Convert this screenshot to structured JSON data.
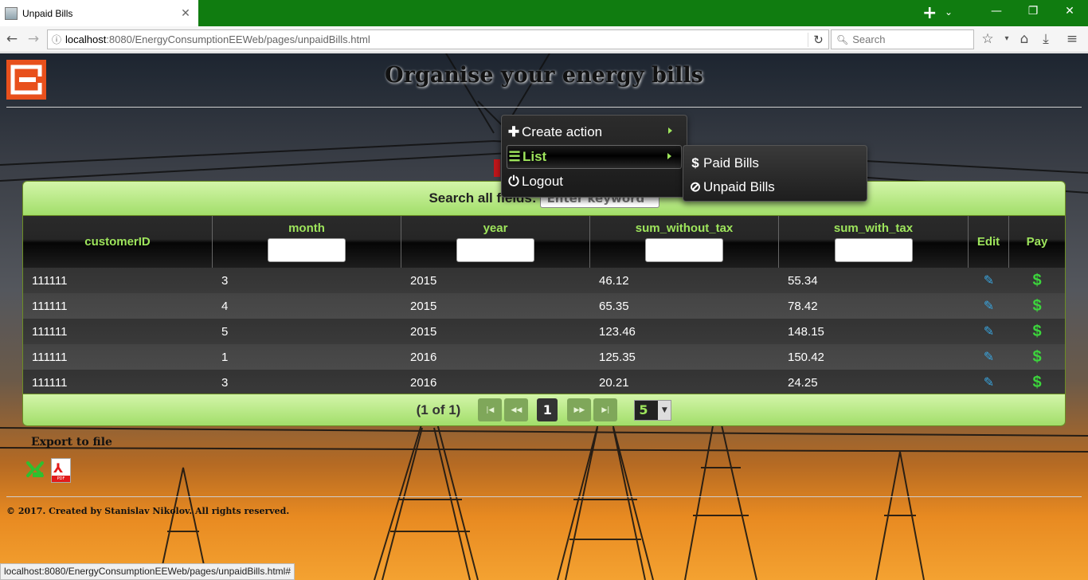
{
  "browser": {
    "tab_title": "Unpaid Bills",
    "tab_close": "✕",
    "url_host": "localhost",
    "url_rest": ":8080/EnergyConsumptionEEWeb/pages/unpaidBills.html",
    "search_placeholder": "Search",
    "status_text": "localhost:8080/EnergyConsumptionEEWeb/pages/unpaidBills.html#",
    "accent_color": "#107c10"
  },
  "header": {
    "title": "Organise your energy bills"
  },
  "menu": {
    "items": [
      {
        "label": "Create action",
        "icon": "plus-icon"
      },
      {
        "label": "List",
        "icon": "list-icon"
      },
      {
        "label": "Logout",
        "icon": "power-icon"
      }
    ],
    "submenu": [
      {
        "label": "Paid Bills",
        "icon": "dollar-icon"
      },
      {
        "label": "Unpaid Bills",
        "icon": "ban-icon"
      }
    ]
  },
  "table": {
    "search_label": "Search all fields:",
    "search_placeholder": "Enter keyword",
    "columns": [
      "customerID",
      "month",
      "year",
      "sum_without_tax",
      "sum_with_tax",
      "Edit",
      "Pay"
    ],
    "rows": [
      [
        "111111",
        "3",
        "2015",
        "46.12",
        "55.34"
      ],
      [
        "111111",
        "4",
        "2015",
        "65.35",
        "78.42"
      ],
      [
        "111111",
        "5",
        "2015",
        "123.46",
        "148.15"
      ],
      [
        "111111",
        "1",
        "2016",
        "125.35",
        "150.42"
      ],
      [
        "111111",
        "3",
        "2016",
        "20.21",
        "24.25"
      ]
    ],
    "paginator": {
      "info": "(1 of 1)",
      "current_page": "1",
      "rows_per_page": "5"
    }
  },
  "export": {
    "label": "Export to file"
  },
  "footer": {
    "text": "© 2017. Created by Stanislav Nikolov. All rights reserved."
  }
}
